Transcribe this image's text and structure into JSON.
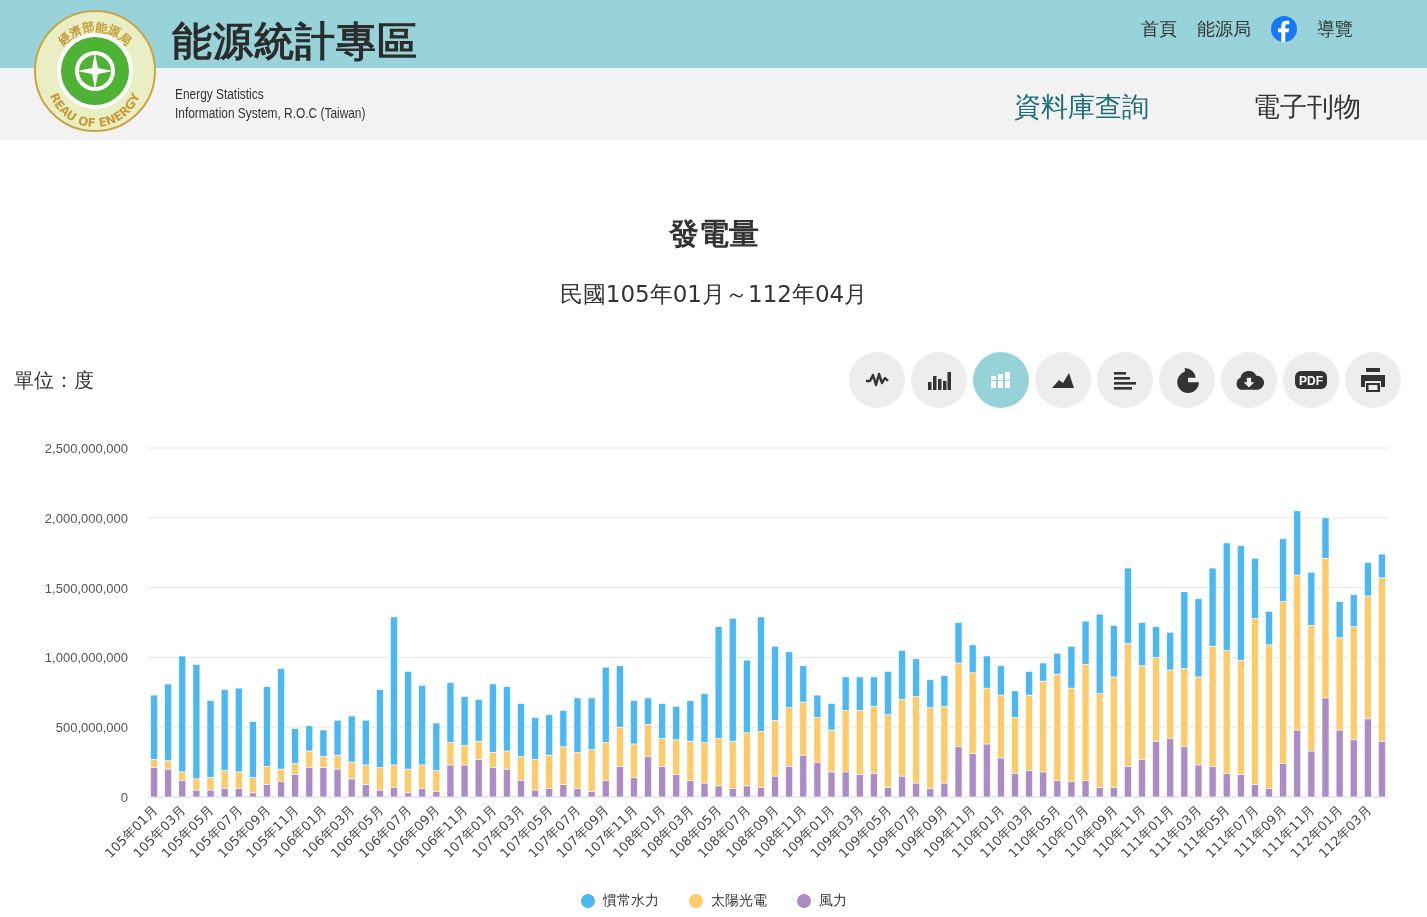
{
  "logo": {
    "top_text": "經濟部能源局",
    "bottom_text": "REAU OF ENERGY"
  },
  "site_title": "能源統計專區",
  "site_subtitle": [
    "Energy Statistics",
    "Information System, R.O.C (Taiwan)"
  ],
  "top_links": [
    {
      "kind": "text",
      "label": "首頁"
    },
    {
      "kind": "text",
      "label": "能源局"
    },
    {
      "kind": "facebook"
    },
    {
      "kind": "text",
      "label": "導覽"
    }
  ],
  "main_nav": [
    {
      "label": "資料庫查詢",
      "selected": true
    },
    {
      "label": "電子刊物",
      "selected": false
    }
  ],
  "chart_title": "發電量",
  "chart_subtitle": "民國105年01月～112年04月",
  "unit_label": "單位：度",
  "chart_tools": [
    {
      "kind": "line",
      "selected": false
    },
    {
      "kind": "column",
      "selected": false
    },
    {
      "kind": "stacked",
      "selected": true
    },
    {
      "kind": "area",
      "selected": false
    },
    {
      "kind": "bar",
      "selected": false
    },
    {
      "kind": "pie",
      "selected": false
    },
    {
      "kind": "download",
      "selected": false
    },
    {
      "kind": "pdf",
      "label": "PDF",
      "selected": false
    },
    {
      "kind": "print",
      "selected": false
    }
  ],
  "chart_data": {
    "type": "bar",
    "stacked": true,
    "grid": true,
    "ylim": [
      0,
      2500000000
    ],
    "yticks": [
      {
        "value": 0,
        "label": "0"
      },
      {
        "value": 500000000,
        "label": "500,000,000"
      },
      {
        "value": 1000000000,
        "label": "1,000,000,000"
      },
      {
        "value": 1500000000,
        "label": "1,500,000,000"
      },
      {
        "value": 2000000000,
        "label": "2,000,000,000"
      },
      {
        "value": 2500000000,
        "label": "2,500,000,000"
      }
    ],
    "categories": [
      "105年01月",
      null,
      "105年03月",
      null,
      "105年05月",
      null,
      "105年07月",
      null,
      "105年09月",
      null,
      "105年11月",
      null,
      "106年01月",
      null,
      "106年03月",
      null,
      "106年05月",
      null,
      "106年07月",
      null,
      "106年09月",
      null,
      "106年11月",
      null,
      "107年01月",
      null,
      "107年03月",
      null,
      "107年05月",
      null,
      "107年07月",
      null,
      "107年09月",
      null,
      "107年11月",
      null,
      "108年01月",
      null,
      "108年03月",
      null,
      "108年05月",
      null,
      "108年07月",
      null,
      "108年09月",
      null,
      "108年11月",
      null,
      "109年01月",
      null,
      "109年03月",
      null,
      "109年05月",
      null,
      "109年07月",
      null,
      "109年09月",
      null,
      "109年11月",
      null,
      "110年01月",
      null,
      "110年03月",
      null,
      "110年05月",
      null,
      "110年07月",
      null,
      "110年09月",
      null,
      "110年11月",
      null,
      "111年01月",
      null,
      "111年03月",
      null,
      "111年05月",
      null,
      "111年07月",
      null,
      "111年09月",
      null,
      "111年11月",
      null,
      "112年01月",
      null,
      "112年03月",
      null
    ],
    "series": [
      {
        "name": "慣常水力",
        "color": "#4cb8f2",
        "values": [
          460000000,
          550000000,
          830000000,
          820000000,
          550000000,
          580000000,
          600000000,
          400000000,
          570000000,
          720000000,
          250000000,
          180000000,
          190000000,
          250000000,
          330000000,
          320000000,
          560000000,
          1060000000,
          700000000,
          570000000,
          340000000,
          430000000,
          350000000,
          300000000,
          490000000,
          460000000,
          380000000,
          300000000,
          290000000,
          260000000,
          390000000,
          370000000,
          540000000,
          440000000,
          310000000,
          190000000,
          250000000,
          240000000,
          290000000,
          350000000,
          800000000,
          880000000,
          520000000,
          820000000,
          530000000,
          400000000,
          260000000,
          160000000,
          190000000,
          240000000,
          240000000,
          210000000,
          310000000,
          350000000,
          270000000,
          200000000,
          220000000,
          290000000,
          200000000,
          230000000,
          210000000,
          190000000,
          170000000,
          130000000,
          150000000,
          300000000,
          310000000,
          570000000,
          370000000,
          540000000,
          310000000,
          220000000,
          270000000,
          550000000,
          560000000,
          560000000,
          770000000,
          820000000,
          430000000,
          240000000,
          450000000,
          460000000,
          380000000,
          290000000,
          260000000,
          230000000,
          240000000,
          170000000
        ]
      },
      {
        "name": "太陽光電",
        "color": "#fecb6a",
        "values": [
          60000000,
          60000000,
          60000000,
          80000000,
          90000000,
          130000000,
          120000000,
          110000000,
          130000000,
          90000000,
          80000000,
          120000000,
          80000000,
          100000000,
          120000000,
          140000000,
          160000000,
          160000000,
          170000000,
          170000000,
          150000000,
          160000000,
          140000000,
          130000000,
          110000000,
          130000000,
          170000000,
          220000000,
          240000000,
          270000000,
          260000000,
          300000000,
          270000000,
          280000000,
          240000000,
          230000000,
          200000000,
          250000000,
          280000000,
          290000000,
          340000000,
          340000000,
          380000000,
          400000000,
          400000000,
          420000000,
          380000000,
          320000000,
          300000000,
          440000000,
          460000000,
          480000000,
          520000000,
          550000000,
          620000000,
          580000000,
          550000000,
          600000000,
          580000000,
          400000000,
          450000000,
          400000000,
          540000000,
          650000000,
          760000000,
          670000000,
          830000000,
          670000000,
          790000000,
          880000000,
          670000000,
          600000000,
          490000000,
          560000000,
          630000000,
          860000000,
          880000000,
          820000000,
          1190000000,
          1030000000,
          1160000000,
          1110000000,
          900000000,
          1000000000,
          660000000,
          810000000,
          880000000,
          1170000000
        ]
      },
      {
        "name": "風力",
        "color": "#ad8bc5",
        "values": [
          210000000,
          200000000,
          120000000,
          50000000,
          50000000,
          60000000,
          60000000,
          30000000,
          90000000,
          110000000,
          160000000,
          210000000,
          210000000,
          200000000,
          130000000,
          90000000,
          50000000,
          70000000,
          30000000,
          60000000,
          40000000,
          230000000,
          230000000,
          270000000,
          210000000,
          200000000,
          120000000,
          50000000,
          60000000,
          90000000,
          60000000,
          40000000,
          120000000,
          220000000,
          140000000,
          290000000,
          220000000,
          160000000,
          120000000,
          100000000,
          80000000,
          60000000,
          80000000,
          70000000,
          150000000,
          220000000,
          300000000,
          250000000,
          180000000,
          180000000,
          160000000,
          170000000,
          70000000,
          150000000,
          100000000,
          60000000,
          100000000,
          360000000,
          310000000,
          380000000,
          280000000,
          170000000,
          190000000,
          180000000,
          120000000,
          110000000,
          120000000,
          70000000,
          70000000,
          220000000,
          270000000,
          400000000,
          420000000,
          360000000,
          230000000,
          220000000,
          170000000,
          160000000,
          90000000,
          60000000,
          240000000,
          480000000,
          330000000,
          710000000,
          480000000,
          410000000,
          560000000,
          400000000
        ]
      }
    ]
  }
}
